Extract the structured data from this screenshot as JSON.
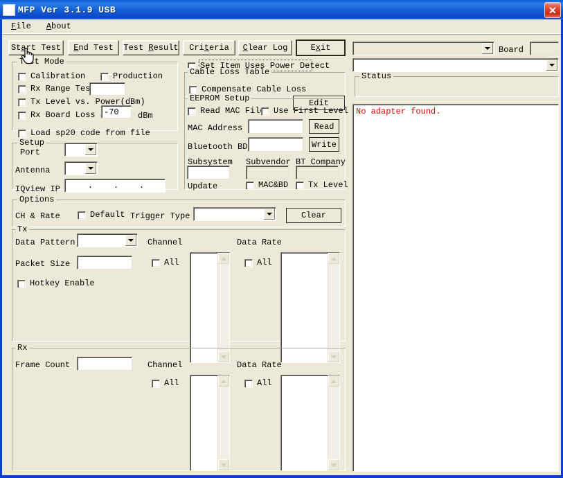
{
  "window": {
    "title": "MFP Ver 3.1.9 USB",
    "close_label": "✕",
    "icon": "app-icon"
  },
  "menu": {
    "items": [
      {
        "label": "File",
        "accel": "F"
      },
      {
        "label": "About",
        "accel": "A"
      }
    ]
  },
  "toolbar": {
    "buttons": [
      {
        "label": "Start Test"
      },
      {
        "label": "End Test"
      },
      {
        "label": "Test Result"
      },
      {
        "label": "Criteria"
      },
      {
        "label": "Clear Log"
      },
      {
        "label": "Exit"
      }
    ]
  },
  "test_mode": {
    "legend": "Test Mode",
    "calibration": "Calibration",
    "production": "Production",
    "rx_range_test": "Rx Range Test",
    "rx_range_value": "",
    "tx_level_vs_power": "Tx Level vs. Power(dBm)",
    "rx_board_loss_at": "Rx Board Loss at",
    "rx_board_loss_value": "-70",
    "dbm_unit": "dBm",
    "load_sp20": "Load sp20 code from file"
  },
  "setup": {
    "legend": "Setup",
    "port_label": "Port",
    "port_value": "",
    "antenna_label": "Antenna",
    "antenna_value": "",
    "iqview_ip_label": "IQview IP",
    "iqview_ip_value": ""
  },
  "power_detect": {
    "label": "Set Item Uses Power Detect"
  },
  "cable_loss": {
    "legend": "Cable Loss Table",
    "compensate": "Compensate Cable Loss",
    "edit_button": "Edit"
  },
  "eeprom": {
    "legend": "EEPROM Setup",
    "read_mac_file": "Read MAC File",
    "use_first_level": "Use First Level",
    "mac_address_label": "MAC Address",
    "mac_address_value": "",
    "read_button": "Read",
    "bluetooth_bd_label": "Bluetooth BD",
    "bluetooth_bd_value": "",
    "write_button": "Write",
    "subsystem_label": "Subsystem",
    "subsystem_value": "",
    "subvendor_label": "Subvendor",
    "subvendor_value": "",
    "bt_company_label": "BT Company",
    "bt_company_value": "",
    "update_label": "Update",
    "mac_bd_checkbox": "MAC&BD",
    "tx_level_checkbox": "Tx Level"
  },
  "options": {
    "legend": "Options",
    "ch_rate_label": "CH & Rate",
    "default_checkbox": "Default",
    "trigger_type_label": "Trigger Type",
    "trigger_type_value": "",
    "clear_button": "Clear"
  },
  "tx": {
    "legend": "Tx",
    "data_pattern_label": "Data Pattern",
    "data_pattern_value": "",
    "packet_size_label": "Packet Size",
    "packet_size_value": "",
    "hotkey_enable": "Hotkey Enable",
    "channel_label": "Channel",
    "channel_all": "All",
    "channel_items": [],
    "data_rate_label": "Data Rate",
    "data_rate_all": "All",
    "data_rate_items": []
  },
  "rx": {
    "legend": "Rx",
    "frame_count_label": "Frame Count",
    "frame_count_value": "",
    "channel_label": "Channel",
    "channel_all": "All",
    "channel_items": [],
    "data_rate_label": "Data Rate",
    "data_rate_all": "All",
    "data_rate_items": []
  },
  "right_panel": {
    "adapter_combo_value": "",
    "board_label": "Board",
    "board_value": "",
    "device_combo_value": "",
    "status_legend": "Status",
    "status_text": "",
    "log_lines": [
      "No adapter found."
    ]
  },
  "colors": {
    "titlebar_blue": "#0a47c4",
    "face": "#ece9d8",
    "error_red": "#e00000",
    "close_red": "#c62d17"
  }
}
